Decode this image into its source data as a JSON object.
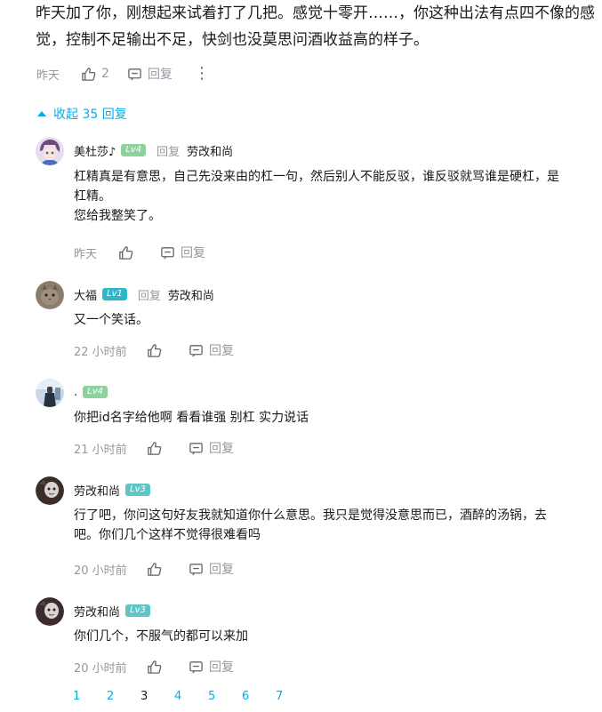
{
  "parent": {
    "text_line1": "昨天加了你，刚想起来试着打了几把。感觉十零开……，你这种出法有点四不像的感",
    "text_line2": "觉，控制不足输出不足，快剑也没莫思问酒收益高的样子。",
    "time": "昨天",
    "likes": "2",
    "reply_label": "回复",
    "more": "⋮"
  },
  "collapse": {
    "label": "收起 35 回复"
  },
  "reply_label": "回复",
  "replies": [
    {
      "name": "美杜莎♪",
      "level": "Lv4",
      "level_color": "#8bd29b",
      "reply_word": "回复",
      "reply_target": "劳改和尚",
      "lines": [
        "杠精真是有意思，自己先没来由的杠一句，然后别人不能反驳，谁反驳就骂谁是硬杠，是",
        "杠精。",
        "您给我整笑了。"
      ],
      "time": "昨天",
      "avatar": "avatar-anime-girl"
    },
    {
      "name": "大福",
      "level": "Lv1",
      "level_color": "#2db8c8",
      "reply_word": "回复",
      "reply_target": "劳改和尚",
      "lines": [
        "又一个笑话。"
      ],
      "time": "22 小时前",
      "avatar": "avatar-cat"
    },
    {
      "name": ".",
      "level": "Lv4",
      "level_color": "#8bd29b",
      "reply_word": "",
      "reply_target": "",
      "lines": [
        "你把id名字给他啊 看看谁强 别杠 实力说话"
      ],
      "time": "21 小时前",
      "avatar": "avatar-figure"
    },
    {
      "name": "劳改和尚",
      "level": "Lv3",
      "level_color": "#5ec6c7",
      "reply_word": "",
      "reply_target": "",
      "lines": [
        "行了吧，你问这句好友我就知道你什么意思。我只是觉得没意思而已，酒醉的汤锅，去",
        "吧。你们几个这样不觉得很难看吗"
      ],
      "time": "20 小时前",
      "avatar": "avatar-dark"
    },
    {
      "name": "劳改和尚",
      "level": "Lv3",
      "level_color": "#5ec6c7",
      "reply_word": "",
      "reply_target": "",
      "lines": [
        "你们几个，不服气的都可以来加"
      ],
      "time": "20 小时前",
      "avatar": "avatar-dark"
    }
  ],
  "pagination": {
    "pages": [
      "1",
      "2",
      "3",
      "4",
      "5",
      "6",
      "7"
    ],
    "current": "3"
  },
  "colors": {
    "accent": "#00aeec",
    "muted": "#9499a0"
  }
}
